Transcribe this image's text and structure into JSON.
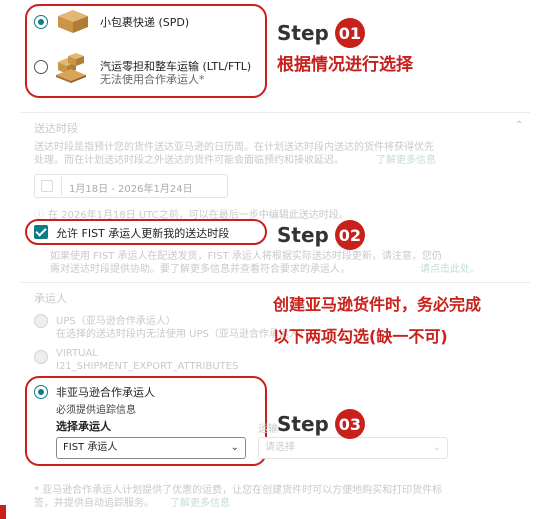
{
  "shipping_mode": {
    "spd_label": "小包裹快递 (SPD)",
    "ltl_label": "汽运零担和整车运输 (LTL/FTL)",
    "ltl_sub": "无法使用合作承运人*"
  },
  "annotations": {
    "step_word": "Step",
    "step1_num": "01",
    "step1_note": "根据情况进行选择",
    "step2_num": "02",
    "step3_num": "03",
    "note_line1": "创建亚马逊货件时，务必完成",
    "note_line2": "以下两项勾选(缺一不可)"
  },
  "delivery_window": {
    "title": "送达时段",
    "desc_line1": "送达时段是指预计您的货件送达亚马逊的日历周。在计划送达时段内送达的货件将获得优先",
    "desc_line2": "处理。而在计划送达时段之外送达的货件可能会面临预约和接收延迟。",
    "learn_more": "了解更多信息",
    "date_range": "1月18日 - 2026年1月24日",
    "info_text": "在 2026年1月18日 UTC之前，可以在最后一步中编辑此送达时段。",
    "allow_update_label": "允许 FIST 承运人更新我的送达时段",
    "hint_line1": "如果使用 FIST 承运人在配送发货，FIST 承运人将根据实际送达时段更新，请注意，您仍",
    "hint_line2": "需对送达时段提供协助。要了解更多信息并查看符合要求的承运人，",
    "hint_link": "请点击此处。"
  },
  "carrier": {
    "title": "承运人",
    "ups_label": "UPS（亚马逊合作承运人）",
    "ups_sub": "在选择的送达时段内无法使用 UPS（亚马逊合作承运人）",
    "virtual_label": "VIRTUAL",
    "virtual_sub": "I21_SHIPMENT_EXPORT_ATTRIBUTES",
    "non_partner_label": "非亚马逊合作承运人",
    "non_partner_sub": "必须提供追踪信息",
    "select_carrier_label": "选择承运人",
    "selected_carrier": "FIST 承运人",
    "mode_label": "运输",
    "mode_placeholder": "请选择",
    "footnote_line1": "* 亚马逊合作承运人计划提供了优惠的运费，让您在创建货件时可以方便地购买和打印货件标",
    "footnote_line2": "签，并提供自动追踪服务。",
    "footnote_link": "了解更多信息"
  },
  "colors": {
    "accent": "#0a7d86",
    "annotation_red": "#c8201a"
  },
  "icons": {
    "package": "package-box-icon",
    "pallet": "pallet-boxes-icon",
    "calendar": "calendar-icon",
    "info": "info-icon",
    "chevron": "chevron-down-icon"
  }
}
